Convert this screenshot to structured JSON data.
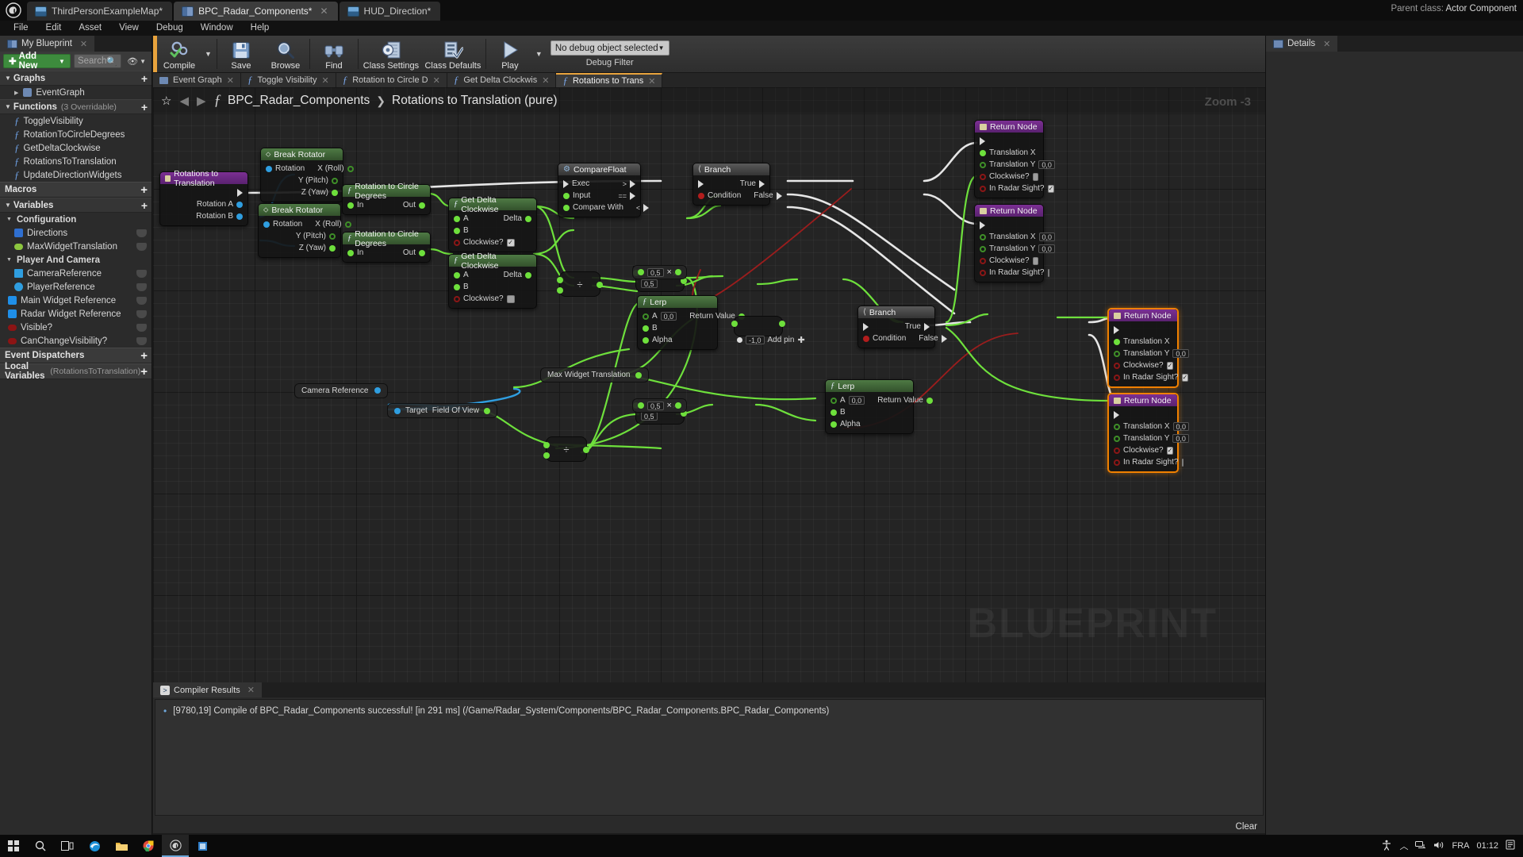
{
  "window": {
    "tabs": [
      {
        "label": "ThirdPersonExampleMap*",
        "icon": "map-icon",
        "active": false
      },
      {
        "label": "BPC_Radar_Components*",
        "icon": "blueprint-icon",
        "active": true
      },
      {
        "label": "HUD_Direction*",
        "icon": "widget-icon",
        "active": false
      }
    ],
    "parent_class_label": "Parent class:",
    "parent_class_value": "Actor Component"
  },
  "menu": {
    "items": [
      "File",
      "Edit",
      "Asset",
      "View",
      "Debug",
      "Window",
      "Help"
    ]
  },
  "my_blueprint": {
    "tab_label": "My Blueprint",
    "add_new_label": "Add New",
    "search_placeholder": "Search",
    "sections": {
      "graphs": {
        "label": "Graphs",
        "items": [
          {
            "label": "EventGraph",
            "icon": "event-graph-icon"
          }
        ]
      },
      "functions": {
        "label": "Functions",
        "sub": "(3 Overridable)",
        "items": [
          {
            "label": "ToggleVisibility",
            "icon": "function-icon"
          },
          {
            "label": "RotationToCircleDegrees",
            "icon": "function-icon"
          },
          {
            "label": "GetDeltaClockwise",
            "icon": "function-icon"
          },
          {
            "label": "RotationsToTranslation",
            "icon": "function-icon"
          },
          {
            "label": "UpdateDirectionWidgets",
            "icon": "function-icon"
          }
        ]
      },
      "macros": {
        "label": "Macros",
        "items": []
      },
      "variables": {
        "label": "Variables"
      },
      "configuration": {
        "label": "Configuration",
        "items": [
          {
            "label": "Directions",
            "icon": "array-icon",
            "color": "#2f6fd0"
          },
          {
            "label": "MaxWidgetTranslation",
            "icon": "float-icon",
            "color": "#8cc63f"
          }
        ]
      },
      "player_and_camera": {
        "label": "Player And Camera",
        "items": [
          {
            "label": "CameraReference",
            "icon": "camera-icon",
            "color": "#2f9ee0"
          },
          {
            "label": "PlayerReference",
            "icon": "object-icon",
            "color": "#2f9ee0"
          }
        ]
      },
      "ungrouped": [
        {
          "label": "Main Widget Reference",
          "icon": "object-icon",
          "color": "#1f8fe8"
        },
        {
          "label": "Radar Widget Reference",
          "icon": "object-icon",
          "color": "#1f8fe8"
        },
        {
          "label": "Visible?",
          "icon": "bool-icon",
          "color": "#8c1414"
        },
        {
          "label": "CanChangeVisibility?",
          "icon": "bool-icon",
          "color": "#8c1414"
        }
      ],
      "event_dispatchers": {
        "label": "Event Dispatchers"
      },
      "local_variables": {
        "label": "Local Variables",
        "sub": "(RotationsToTranslation)"
      }
    }
  },
  "details_panel": {
    "tab_label": "Details"
  },
  "toolbar": {
    "compile_label": "Compile",
    "save_label": "Save",
    "browse_label": "Browse",
    "find_label": "Find",
    "class_settings_label": "Class Settings",
    "class_defaults_label": "Class Defaults",
    "play_label": "Play",
    "debug_object_value": "No debug object selected",
    "debug_filter_label": "Debug Filter"
  },
  "graph_tabs": [
    {
      "label": "Event Graph",
      "icon": "event-graph-icon",
      "active": false,
      "closable": true
    },
    {
      "label": "Toggle Visibility",
      "icon": "function-icon",
      "active": false,
      "closable": true
    },
    {
      "label": "Rotation to Circle D",
      "icon": "function-icon",
      "active": false,
      "closable": true
    },
    {
      "label": "Get Delta Clockwis",
      "icon": "function-icon",
      "active": false,
      "closable": true
    },
    {
      "label": "Rotations to Trans",
      "icon": "function-icon",
      "active": true,
      "closable": true
    }
  ],
  "breadcrumb": {
    "root": "BPC_Radar_Components",
    "separator": "❯",
    "current": "Rotations to Translation (pure)",
    "zoom_label": "Zoom -3",
    "watermark": "BLUEPRINT"
  },
  "graph_nodes": {
    "entry": {
      "title": "Rotations to Translation",
      "pins": [
        "Rotation A",
        "Rotation B"
      ]
    },
    "break_rotator_1": {
      "title": "Break Rotator",
      "in": "Rotation",
      "outs": [
        "X (Roll)",
        "Y (Pitch)",
        "Z (Yaw)"
      ]
    },
    "break_rotator_2": {
      "title": "Break Rotator",
      "in": "Rotation",
      "outs": [
        "X (Roll)",
        "Y (Pitch)",
        "Z (Yaw)"
      ]
    },
    "rot_circle_1": {
      "title": "Rotation to Circle Degrees",
      "in": "In",
      "out": "Out"
    },
    "rot_circle_2": {
      "title": "Rotation to Circle Degrees",
      "in": "In",
      "out": "Out"
    },
    "get_delta_1": {
      "title": "Get Delta Clockwise",
      "ins": [
        "A",
        "B"
      ],
      "bool_label": "Clockwise?",
      "bool_value": true,
      "out": "Delta"
    },
    "get_delta_2": {
      "title": "Get Delta Clockwise",
      "ins": [
        "A",
        "B"
      ],
      "bool_label": "Clockwise?",
      "bool_value": false,
      "out": "Delta"
    },
    "compare_float": {
      "title": "CompareFloat",
      "ins": [
        "Exec",
        "Input",
        "Compare With"
      ],
      "outs": [
        ">",
        "==",
        "<"
      ]
    },
    "branch_1": {
      "title": "Branch",
      "condition_label": "Condition",
      "outs": [
        "True",
        "False"
      ]
    },
    "branch_2": {
      "title": "Branch",
      "condition_label": "Condition",
      "outs": [
        "True",
        "False"
      ]
    },
    "lerp_1": {
      "title": "Lerp",
      "ins": [
        "A",
        "B",
        "Alpha"
      ],
      "a_value": "0,0",
      "out": "Return Value"
    },
    "lerp_2": {
      "title": "Lerp",
      "ins": [
        "A",
        "B",
        "Alpha"
      ],
      "a_value": "0,0",
      "out": "Return Value"
    },
    "camera_ref": {
      "title": "Camera Reference"
    },
    "field_of_view": {
      "target_label": "Target",
      "out_label": "Field Of View"
    },
    "max_widget_translation": {
      "title": "Max Widget Translation"
    },
    "divide_1": {
      "symbol": "÷"
    },
    "divide_2": {
      "symbol": "÷"
    },
    "multiply_1": {
      "symbol": "×",
      "value": "0,5"
    },
    "multiply_2": {
      "symbol": "×",
      "value": "0,5"
    },
    "subtract": {
      "symbol": "−",
      "value": "-1,0",
      "add_pin_label": "Add pin"
    },
    "return_nodes": [
      {
        "title": "Return Node",
        "selected": false,
        "pins": [
          {
            "label": "Translation X",
            "type": "float",
            "filled": true
          },
          {
            "label": "Translation Y",
            "type": "float",
            "value": "0,0"
          },
          {
            "label": "Clockwise?",
            "type": "bool",
            "checked": false
          },
          {
            "label": "In Radar Sight?",
            "type": "bool",
            "checked": true
          }
        ]
      },
      {
        "title": "Return Node",
        "selected": false,
        "pins": [
          {
            "label": "Translation X",
            "type": "float",
            "value": "0,0"
          },
          {
            "label": "Translation Y",
            "type": "float",
            "value": "0,0"
          },
          {
            "label": "Clockwise?",
            "type": "bool",
            "checked": false
          },
          {
            "label": "In Radar Sight?",
            "type": "bool",
            "checked": false
          }
        ]
      },
      {
        "title": "Return Node",
        "selected": true,
        "pins": [
          {
            "label": "Translation X",
            "type": "float",
            "filled": true
          },
          {
            "label": "Translation Y",
            "type": "float",
            "value": "0,0"
          },
          {
            "label": "Clockwise?",
            "type": "bool",
            "checked": true
          },
          {
            "label": "In Radar Sight?",
            "type": "bool",
            "checked": true
          }
        ]
      },
      {
        "title": "Return Node",
        "selected": true,
        "pins": [
          {
            "label": "Translation X",
            "type": "float",
            "value": "0,0"
          },
          {
            "label": "Translation Y",
            "type": "float",
            "value": "0,0"
          },
          {
            "label": "Clockwise?",
            "type": "bool",
            "checked": true
          },
          {
            "label": "In Radar Sight?",
            "type": "bool",
            "checked": false
          }
        ]
      }
    ]
  },
  "compiler_results": {
    "tab_label": "Compiler Results",
    "message": "[9780,19] Compile of BPC_Radar_Components successful! [in 291 ms] (/Game/Radar_System/Components/BPC_Radar_Components.BPC_Radar_Components)",
    "clear_label": "Clear"
  },
  "taskbar": {
    "icons": [
      "start-icon",
      "search-icon",
      "task-view-icon",
      "edge-icon",
      "file-explorer-icon",
      "chrome-icon",
      "unreal-icon",
      "store-icon"
    ],
    "language": "FRA",
    "clock": "01:12"
  },
  "colors": {
    "accent_orange": "#e8a33d",
    "exec_white": "#e0e0e0",
    "float_green": "#6ee03c",
    "bool_red": "#b21d1d",
    "object_blue": "#2f9ee0",
    "selection_orange": "#f08000"
  }
}
